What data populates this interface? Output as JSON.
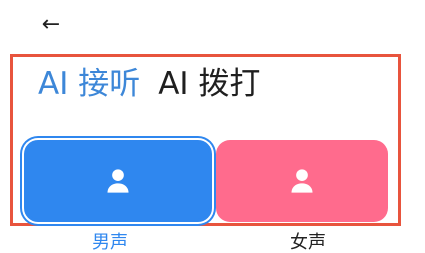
{
  "header": {
    "back_icon": "arrow-left-icon"
  },
  "tabs": {
    "answer": {
      "label": "AI 接听",
      "active": true
    },
    "dial": {
      "label": "AI 拨打",
      "active": false
    }
  },
  "gender_buttons": {
    "male": {
      "icon": "person-icon",
      "selected": true,
      "color": "#2f87ef"
    },
    "female": {
      "icon": "person-icon",
      "selected": false,
      "color": "#ff6b8d"
    }
  },
  "highlight_color": "#e8543d",
  "labels": {
    "male": "男声",
    "female": "女声"
  }
}
